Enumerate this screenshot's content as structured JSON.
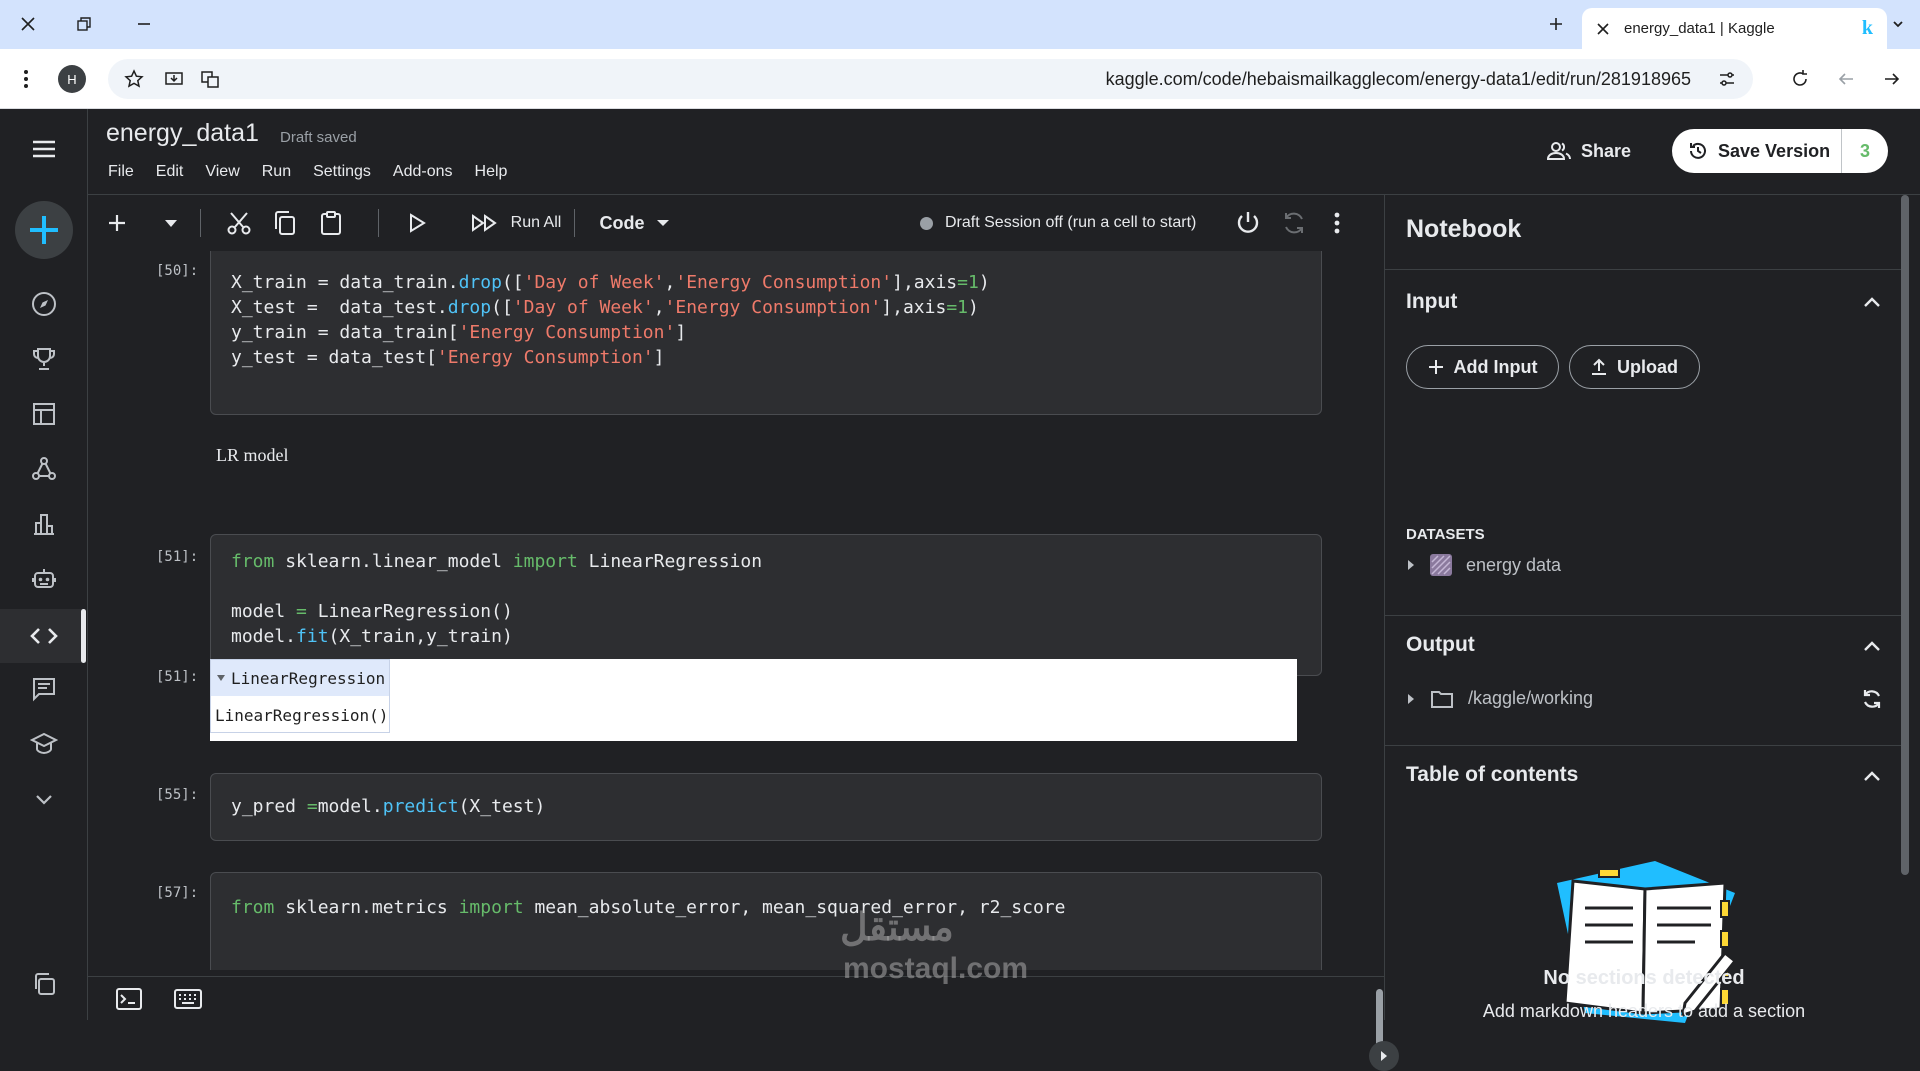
{
  "browser": {
    "tab_title": "energy_data1 | Kaggle",
    "tab_favicon": "k",
    "url": "kaggle.com/code/hebaismailkagglecom/energy-data1/edit/run/281918965",
    "profile_initial": "H"
  },
  "header": {
    "notebook_title": "energy_data1",
    "draft_status": "Draft saved",
    "menu": [
      "File",
      "Edit",
      "View",
      "Run",
      "Settings",
      "Add-ons",
      "Help"
    ],
    "share_label": "Share",
    "save_version_label": "Save Version",
    "version_count": "3"
  },
  "toolbar": {
    "run_all_label": "Run All",
    "cell_type": "Code",
    "session_status": "Draft Session off (run a cell to start)"
  },
  "cells": {
    "c50_prompt": "[50]:",
    "md_text": "LR model",
    "c51_prompt": "[51]:",
    "out51_prompt": "[51]:",
    "out51_header": "LinearRegression",
    "out51_body": "LinearRegression()",
    "c55_prompt": "[55]:",
    "c57_prompt": "[57]:"
  },
  "right_panel": {
    "title": "Notebook",
    "input_section": "Input",
    "add_input_label": "Add Input",
    "upload_label": "Upload",
    "datasets_label": "DATASETS",
    "dataset_name": "energy data",
    "output_section": "Output",
    "output_path": "/kaggle/working",
    "toc_section": "Table of contents",
    "no_sections": "No sections detected",
    "add_markdown_hint": "Add markdown headers to add a section"
  },
  "watermark": {
    "arabic": "مستقل",
    "latin": "mostaql.com"
  }
}
